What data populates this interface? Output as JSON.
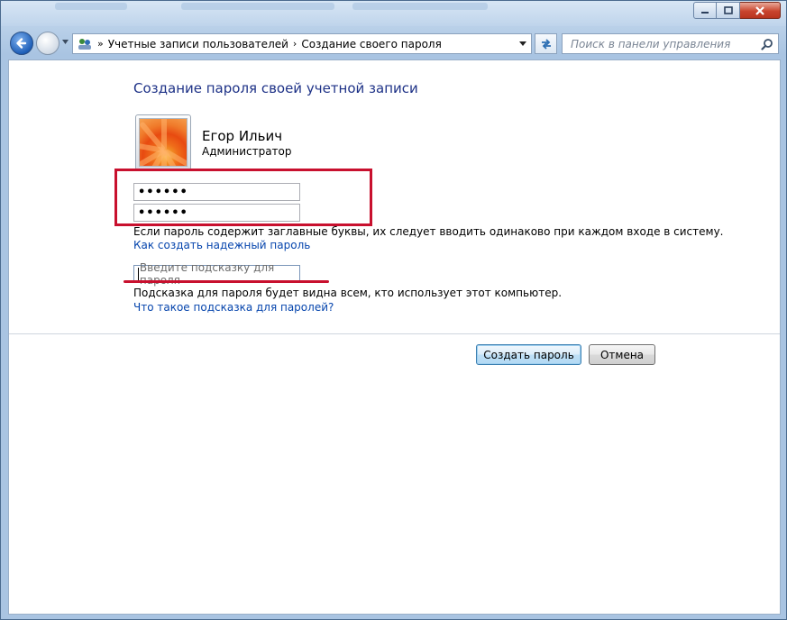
{
  "window": {
    "caption_buttons": [
      "minimize",
      "maximize",
      "close"
    ]
  },
  "nav": {
    "breadcrumb": [
      "Учетные записи пользователей",
      "Создание своего пароля"
    ],
    "search_placeholder": "Поиск в панели управления"
  },
  "page": {
    "heading": "Создание пароля своей учетной записи",
    "user_name": "Егор Ильич",
    "user_role": "Администратор",
    "password_value": "••••••",
    "confirm_value": "••••••",
    "case_info": "Если пароль содержит заглавные буквы, их следует вводить одинаково при каждом входе в систему.",
    "strong_link": "Как создать надежный пароль",
    "hint_placeholder": "Введите подсказку для пароля",
    "hint_info": "Подсказка для пароля будет видна всем, кто использует этот компьютер.",
    "hint_link": "Что такое подсказка для паролей?",
    "create_button": "Создать пароль",
    "cancel_button": "Отмена"
  },
  "colors": {
    "heading": "#1e3287",
    "link": "#0645ad",
    "highlight": "#c8102e"
  },
  "icons": [
    "back-arrow-icon",
    "forward-arrow-icon",
    "control-panel-icon",
    "refresh-icon",
    "search-icon",
    "avatar-flower"
  ]
}
